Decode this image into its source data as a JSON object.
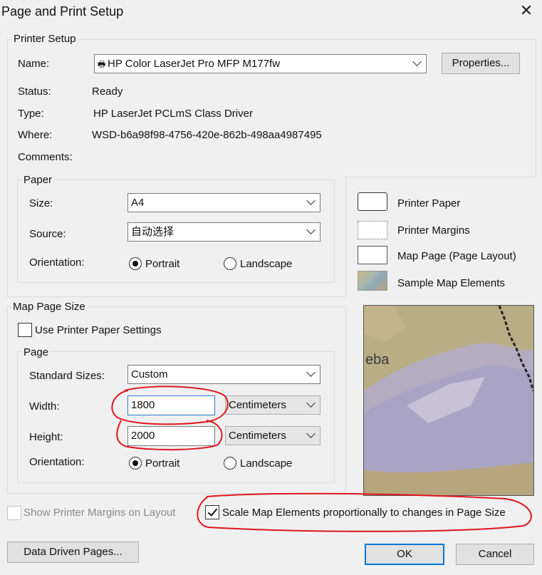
{
  "dialog": {
    "title": "Page and Print Setup",
    "close_glyph": "✕"
  },
  "printer_setup": {
    "legend": "Printer Setup",
    "name_label": "Name:",
    "name_value": "HP Color LaserJet Pro MFP M177fw",
    "properties_button": "Properties...",
    "status_label": "Status:",
    "status_value": "Ready",
    "type_label": "Type:",
    "type_value": "HP LaserJet PCLmS Class Driver",
    "where_label": "Where:",
    "where_value": "WSD-b6a98f98-4756-420e-862b-498aa4987495",
    "comments_label": "Comments:"
  },
  "paper": {
    "legend": "Paper",
    "size_label": "Size:",
    "size_value": "A4",
    "source_label": "Source:",
    "source_value": "自动选择",
    "orientation_label": "Orientation:",
    "portrait": "Portrait",
    "landscape": "Landscape",
    "selected": "portrait"
  },
  "legend_panel": {
    "printer_paper": "Printer Paper",
    "printer_margins": "Printer Margins",
    "map_page": "Map Page (Page Layout)",
    "sample_elements": "Sample Map Elements"
  },
  "map_page_size": {
    "legend": "Map Page Size",
    "use_printer_settings": "Use Printer Paper Settings",
    "use_printer_settings_checked": false,
    "page_legend": "Page",
    "standard_sizes_label": "Standard Sizes:",
    "standard_sizes_value": "Custom",
    "width_label": "Width:",
    "width_value": "1800",
    "width_unit": "Centimeters",
    "height_label": "Height:",
    "height_value": "2000",
    "height_unit": "Centimeters",
    "orientation_label": "Orientation:",
    "portrait": "Portrait",
    "landscape": "Landscape",
    "selected": "portrait"
  },
  "preview": {
    "label_text": "eba"
  },
  "options": {
    "show_margins": "Show Printer Margins on Layout",
    "show_margins_checked": false,
    "scale_elements": "Scale Map Elements proportionally to changes in Page Size",
    "scale_elements_checked": true
  },
  "footer": {
    "data_driven_pages": "Data Driven Pages...",
    "ok": "OK",
    "cancel": "Cancel"
  },
  "colors": {
    "annotation_red": "#e0161c",
    "focus_blue": "#0078d7"
  }
}
